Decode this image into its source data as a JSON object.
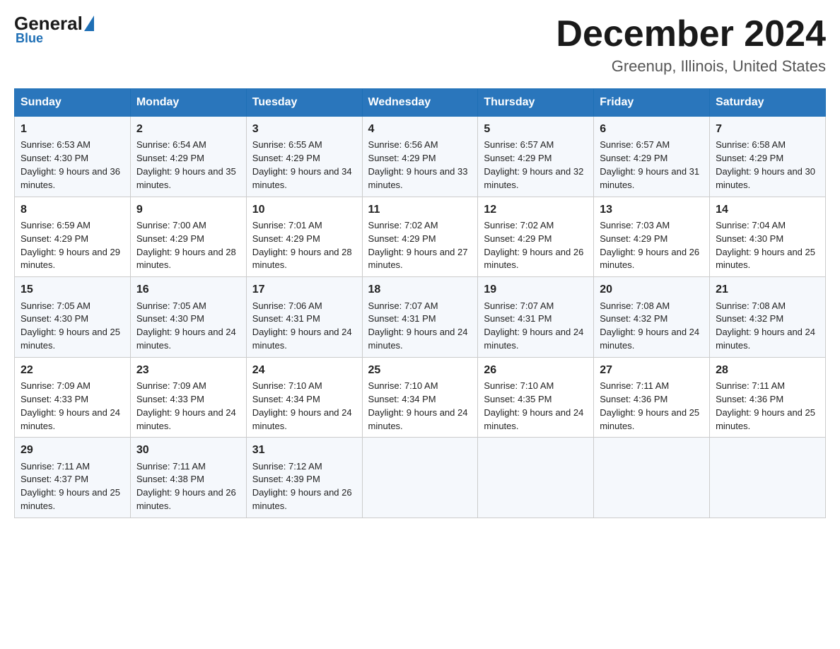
{
  "logo": {
    "general": "General",
    "blue": "Blue",
    "subtitle": "Blue"
  },
  "title": "December 2024",
  "location": "Greenup, Illinois, United States",
  "days_of_week": [
    "Sunday",
    "Monday",
    "Tuesday",
    "Wednesday",
    "Thursday",
    "Friday",
    "Saturday"
  ],
  "weeks": [
    [
      {
        "day": "1",
        "sunrise": "6:53 AM",
        "sunset": "4:30 PM",
        "daylight": "9 hours and 36 minutes."
      },
      {
        "day": "2",
        "sunrise": "6:54 AM",
        "sunset": "4:29 PM",
        "daylight": "9 hours and 35 minutes."
      },
      {
        "day": "3",
        "sunrise": "6:55 AM",
        "sunset": "4:29 PM",
        "daylight": "9 hours and 34 minutes."
      },
      {
        "day": "4",
        "sunrise": "6:56 AM",
        "sunset": "4:29 PM",
        "daylight": "9 hours and 33 minutes."
      },
      {
        "day": "5",
        "sunrise": "6:57 AM",
        "sunset": "4:29 PM",
        "daylight": "9 hours and 32 minutes."
      },
      {
        "day": "6",
        "sunrise": "6:57 AM",
        "sunset": "4:29 PM",
        "daylight": "9 hours and 31 minutes."
      },
      {
        "day": "7",
        "sunrise": "6:58 AM",
        "sunset": "4:29 PM",
        "daylight": "9 hours and 30 minutes."
      }
    ],
    [
      {
        "day": "8",
        "sunrise": "6:59 AM",
        "sunset": "4:29 PM",
        "daylight": "9 hours and 29 minutes."
      },
      {
        "day": "9",
        "sunrise": "7:00 AM",
        "sunset": "4:29 PM",
        "daylight": "9 hours and 28 minutes."
      },
      {
        "day": "10",
        "sunrise": "7:01 AM",
        "sunset": "4:29 PM",
        "daylight": "9 hours and 28 minutes."
      },
      {
        "day": "11",
        "sunrise": "7:02 AM",
        "sunset": "4:29 PM",
        "daylight": "9 hours and 27 minutes."
      },
      {
        "day": "12",
        "sunrise": "7:02 AM",
        "sunset": "4:29 PM",
        "daylight": "9 hours and 26 minutes."
      },
      {
        "day": "13",
        "sunrise": "7:03 AM",
        "sunset": "4:29 PM",
        "daylight": "9 hours and 26 minutes."
      },
      {
        "day": "14",
        "sunrise": "7:04 AM",
        "sunset": "4:30 PM",
        "daylight": "9 hours and 25 minutes."
      }
    ],
    [
      {
        "day": "15",
        "sunrise": "7:05 AM",
        "sunset": "4:30 PM",
        "daylight": "9 hours and 25 minutes."
      },
      {
        "day": "16",
        "sunrise": "7:05 AM",
        "sunset": "4:30 PM",
        "daylight": "9 hours and 24 minutes."
      },
      {
        "day": "17",
        "sunrise": "7:06 AM",
        "sunset": "4:31 PM",
        "daylight": "9 hours and 24 minutes."
      },
      {
        "day": "18",
        "sunrise": "7:07 AM",
        "sunset": "4:31 PM",
        "daylight": "9 hours and 24 minutes."
      },
      {
        "day": "19",
        "sunrise": "7:07 AM",
        "sunset": "4:31 PM",
        "daylight": "9 hours and 24 minutes."
      },
      {
        "day": "20",
        "sunrise": "7:08 AM",
        "sunset": "4:32 PM",
        "daylight": "9 hours and 24 minutes."
      },
      {
        "day": "21",
        "sunrise": "7:08 AM",
        "sunset": "4:32 PM",
        "daylight": "9 hours and 24 minutes."
      }
    ],
    [
      {
        "day": "22",
        "sunrise": "7:09 AM",
        "sunset": "4:33 PM",
        "daylight": "9 hours and 24 minutes."
      },
      {
        "day": "23",
        "sunrise": "7:09 AM",
        "sunset": "4:33 PM",
        "daylight": "9 hours and 24 minutes."
      },
      {
        "day": "24",
        "sunrise": "7:10 AM",
        "sunset": "4:34 PM",
        "daylight": "9 hours and 24 minutes."
      },
      {
        "day": "25",
        "sunrise": "7:10 AM",
        "sunset": "4:34 PM",
        "daylight": "9 hours and 24 minutes."
      },
      {
        "day": "26",
        "sunrise": "7:10 AM",
        "sunset": "4:35 PM",
        "daylight": "9 hours and 24 minutes."
      },
      {
        "day": "27",
        "sunrise": "7:11 AM",
        "sunset": "4:36 PM",
        "daylight": "9 hours and 25 minutes."
      },
      {
        "day": "28",
        "sunrise": "7:11 AM",
        "sunset": "4:36 PM",
        "daylight": "9 hours and 25 minutes."
      }
    ],
    [
      {
        "day": "29",
        "sunrise": "7:11 AM",
        "sunset": "4:37 PM",
        "daylight": "9 hours and 25 minutes."
      },
      {
        "day": "30",
        "sunrise": "7:11 AM",
        "sunset": "4:38 PM",
        "daylight": "9 hours and 26 minutes."
      },
      {
        "day": "31",
        "sunrise": "7:12 AM",
        "sunset": "4:39 PM",
        "daylight": "9 hours and 26 minutes."
      },
      null,
      null,
      null,
      null
    ]
  ]
}
